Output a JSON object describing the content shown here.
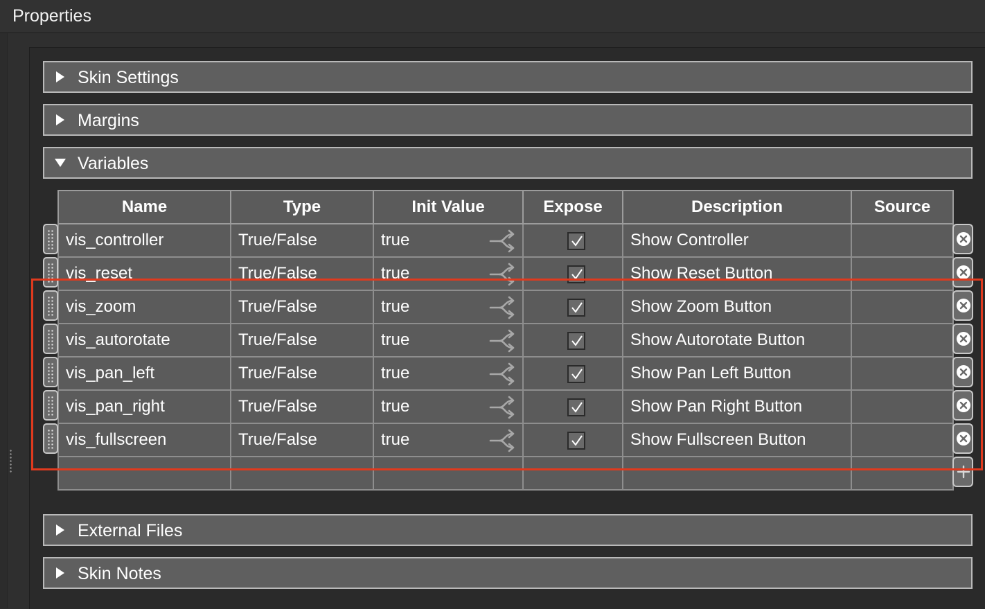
{
  "window": {
    "title": "Properties"
  },
  "sections": {
    "skin_settings": "Skin Settings",
    "margins": "Margins",
    "variables": "Variables",
    "external_files": "External Files",
    "skin_notes": "Skin Notes"
  },
  "table": {
    "headers": {
      "name": "Name",
      "type": "Type",
      "init": "Init Value",
      "expose": "Expose",
      "description": "Description",
      "source": "Source"
    },
    "rows": [
      {
        "name": "vis_controller",
        "type": "True/False",
        "init": "true",
        "expose": true,
        "description": "Show Controller",
        "source": ""
      },
      {
        "name": "vis_reset",
        "type": "True/False",
        "init": "true",
        "expose": true,
        "description": "Show Reset Button",
        "source": ""
      },
      {
        "name": "vis_zoom",
        "type": "True/False",
        "init": "true",
        "expose": true,
        "description": "Show Zoom Button",
        "source": ""
      },
      {
        "name": "vis_autorotate",
        "type": "True/False",
        "init": "true",
        "expose": true,
        "description": "Show Autorotate Button",
        "source": ""
      },
      {
        "name": "vis_pan_left",
        "type": "True/False",
        "init": "true",
        "expose": true,
        "description": "Show Pan Left Button",
        "source": ""
      },
      {
        "name": "vis_pan_right",
        "type": "True/False",
        "init": "true",
        "expose": true,
        "description": "Show Pan Right Button",
        "source": ""
      },
      {
        "name": "vis_fullscreen",
        "type": "True/False",
        "init": "true",
        "expose": true,
        "description": "Show Fullscreen Button",
        "source": ""
      }
    ]
  },
  "icons": {
    "collapsed_arrow": "triangle-right-icon",
    "expanded_arrow": "triangle-down-icon",
    "init_value_link": "branch-arrows-icon",
    "row_remove": "circle-x-icon",
    "row_add": "plus-icon",
    "row_drag": "drag-handle-icon"
  },
  "colors": {
    "highlight": "#e03a1e",
    "section_bg": "#5f5f5f",
    "table_bg": "#5b5b5b"
  }
}
